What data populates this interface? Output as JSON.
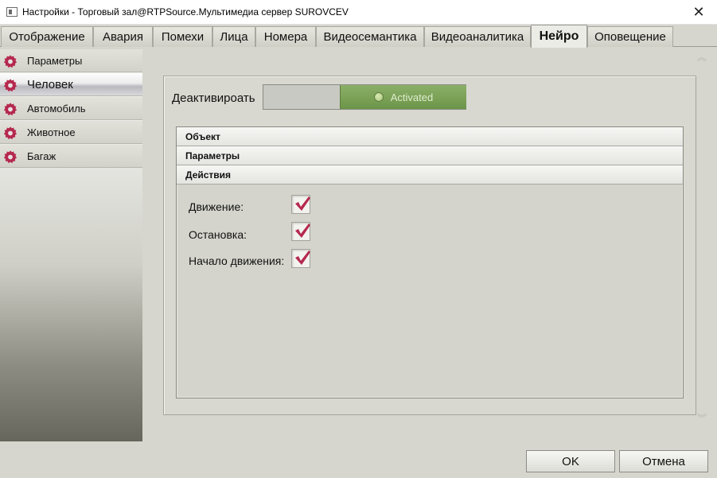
{
  "window": {
    "title": "Настройки - Торговый зал@RTPSource.Мультимедиа сервер SUROVCEV",
    "close_glyph": "✕"
  },
  "tabs": [
    {
      "label": "Отображение",
      "active": false
    },
    {
      "label": "Авария",
      "active": false
    },
    {
      "label": "Помехи",
      "active": false
    },
    {
      "label": "Лица",
      "active": false
    },
    {
      "label": "Номера",
      "active": false
    },
    {
      "label": "Видеосемантика",
      "active": false
    },
    {
      "label": "Видеоаналитика",
      "active": false
    },
    {
      "label": "Нейро",
      "active": true
    },
    {
      "label": "Оповещение",
      "active": false
    }
  ],
  "sidebar": {
    "items": [
      {
        "label": "Параметры",
        "icon": "gear-icon",
        "selected": false
      },
      {
        "label": "Человек",
        "icon": "gear-icon",
        "selected": true
      },
      {
        "label": "Автомобиль",
        "icon": "gear-icon",
        "selected": false
      },
      {
        "label": "Животное",
        "icon": "gear-icon",
        "selected": false
      },
      {
        "label": "Багаж",
        "icon": "gear-icon",
        "selected": false
      }
    ],
    "icon_color": "#b5284e"
  },
  "main": {
    "deactivate_label": "Деактивироать",
    "toggle_state": "Activated",
    "sections": [
      "Объект",
      "Параметры",
      "Действия"
    ],
    "actions": [
      {
        "label": "Движение:",
        "checked": true
      },
      {
        "label": "Остановка:",
        "checked": true
      },
      {
        "label": "Начало движения:",
        "checked": true
      }
    ],
    "check_color": "#b5284e"
  },
  "buttons": {
    "ok": "OK",
    "cancel": "Отмена"
  },
  "scroll": {
    "up_glyph": "︽",
    "down_glyph": "︾"
  }
}
